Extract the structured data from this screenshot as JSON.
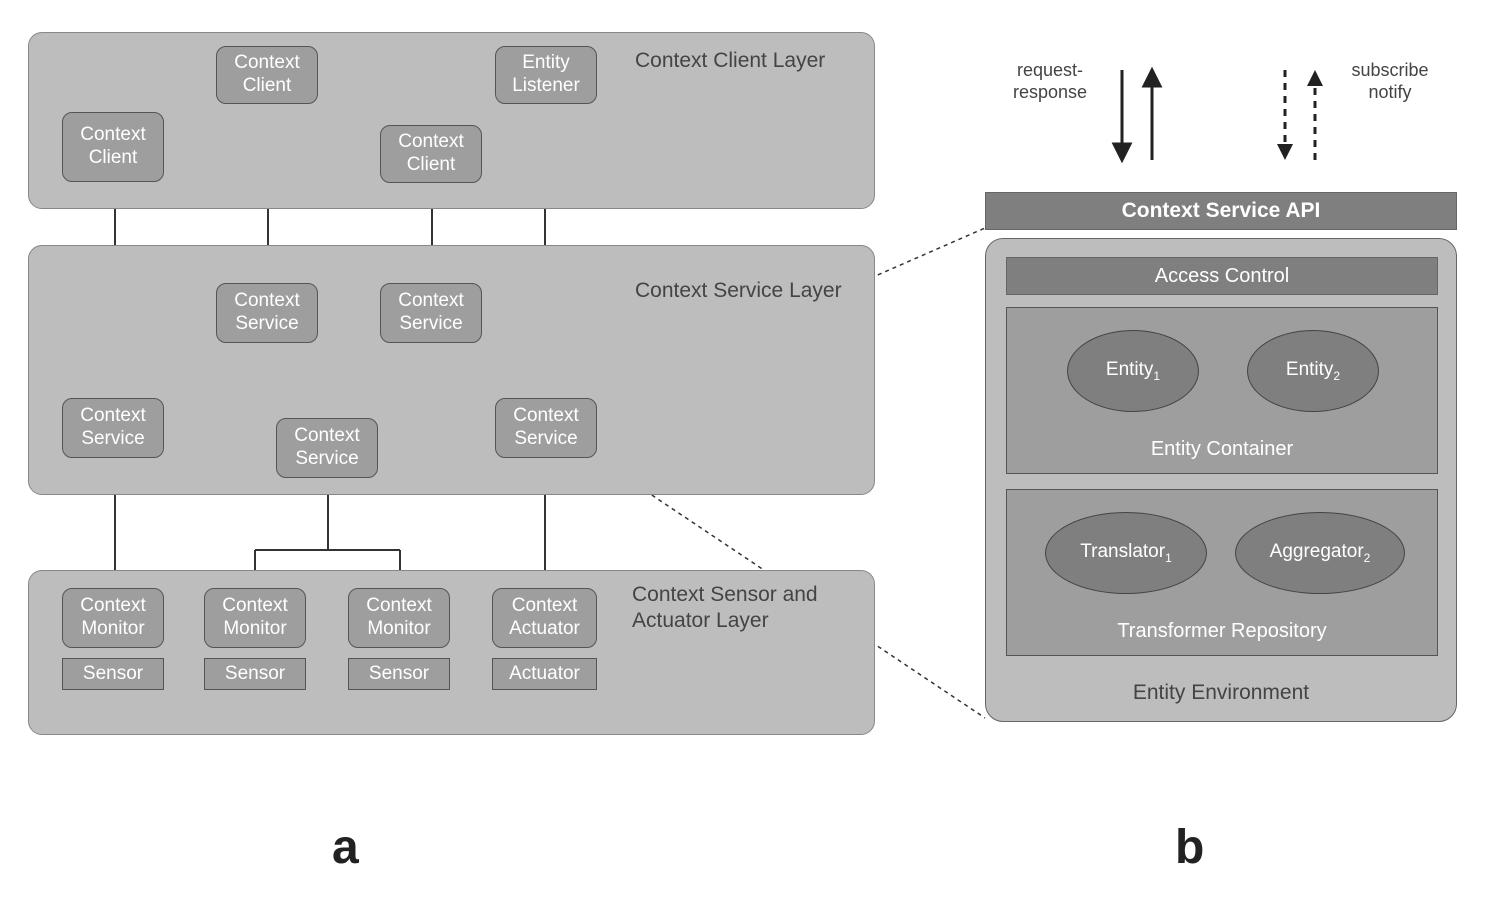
{
  "panel_a": {
    "label": "a",
    "layers": {
      "client": {
        "label": "Context Client Layer",
        "nodes": {
          "cc_left": "Context Client",
          "cc_top": "Context Client",
          "cc_mid": "Context Client",
          "entity_listener": "Entity Listener"
        }
      },
      "service": {
        "label": "Context Service Layer",
        "nodes": {
          "cs_upper_left": "Context Service",
          "cs_upper_right": "Context Service",
          "cs_left": "Context Service",
          "cs_center": "Context Service",
          "cs_right": "Context Service"
        }
      },
      "sensor": {
        "label": "Context Sensor and Actuator Layer",
        "nodes": {
          "cm1": "Context Monitor",
          "cm2": "Context Monitor",
          "cm3": "Context Monitor",
          "ca": "Context Actuator",
          "s1": "Sensor",
          "s2": "Sensor",
          "s3": "Sensor",
          "act": "Actuator"
        }
      }
    }
  },
  "panel_b": {
    "label": "b",
    "legend": {
      "req_resp": "request-\nresponse",
      "sub_notify": "subscribe\nnotify"
    },
    "api_bar": "Context Service API",
    "env_label": "Entity Environment",
    "access_control": "Access Control",
    "entity_container": {
      "label": "Entity Container",
      "entities": {
        "e1": "Entity",
        "e1_sub": "1",
        "e2": "Entity",
        "e2_sub": "2"
      }
    },
    "transformer_repo": {
      "label": "Transformer Repository",
      "items": {
        "t1": "Translator",
        "t1_sub": "1",
        "a2": "Aggregator",
        "a2_sub": "2"
      }
    }
  }
}
